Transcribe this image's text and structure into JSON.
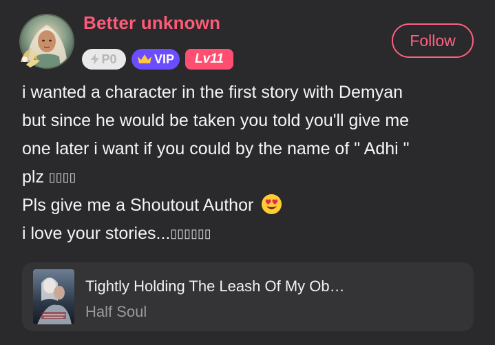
{
  "user": {
    "name": "Better unknown",
    "badges": {
      "power": "P0",
      "vip": "VIP",
      "level": "Lv11"
    }
  },
  "follow_label": "Follow",
  "comment": {
    "lines": [
      "i wanted a character in the first story with Demyan",
      "but since he would be taken you told you'll give me",
      "one later i want if you could by the name of \" Adhi \"",
      "plz ",
      "Pls give me a Shoutout Author ",
      "i love your stories..."
    ],
    "tofu_1": "▯▯▯▯",
    "tofu_2": "▯▯▯▯▯▯",
    "emoji": "heart-eyes-emoji"
  },
  "book": {
    "title": "Tightly Holding The Leash Of My Ob…",
    "author": "Half Soul"
  },
  "colors": {
    "background": "#2a2a2c",
    "username": "#ff5a78",
    "follow": "#ff6080",
    "vip": "#6a4dff",
    "level": "#ff4e6f",
    "card": "#343436"
  },
  "icons": {
    "lightning": "lightning-icon",
    "crown": "crown-icon"
  }
}
